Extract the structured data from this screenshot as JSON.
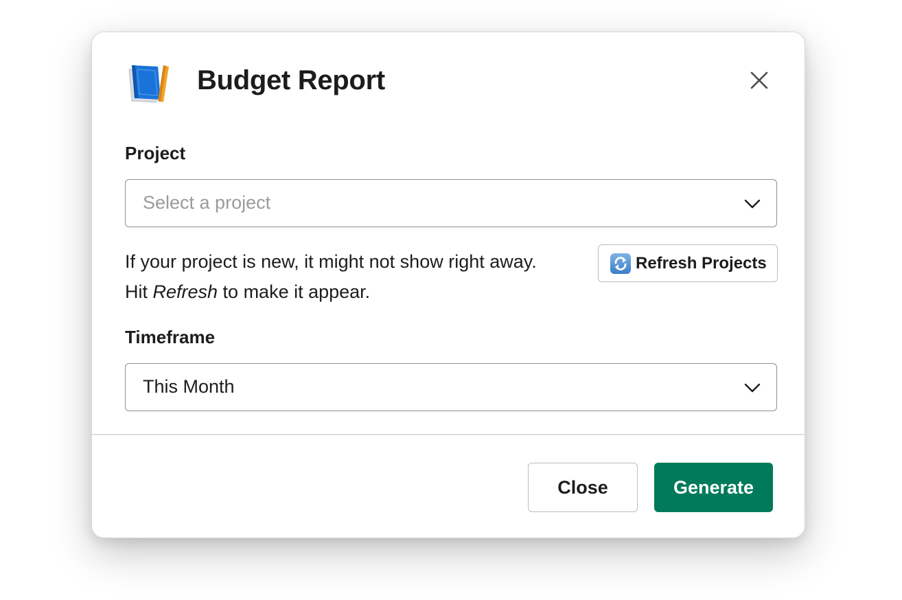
{
  "modal": {
    "title": "Budget Report",
    "title_icon": "blue-book-icon",
    "close_icon": "close-icon"
  },
  "form": {
    "project": {
      "label": "Project",
      "placeholder": "Select a project",
      "icon": "chevron-down-icon"
    },
    "help": {
      "text_before": "If your project is new, it might not show right away. Hit ",
      "text_emphasis": "Refresh",
      "text_after": " to make it appear."
    },
    "refresh_button": {
      "label": "Refresh Projects",
      "icon": "refresh-arrows-icon"
    },
    "timeframe": {
      "label": "Timeframe",
      "value": "This Month",
      "icon": "chevron-down-icon"
    }
  },
  "footer": {
    "close_label": "Close",
    "generate_label": "Generate"
  },
  "colors": {
    "primary": "#007a5a",
    "text": "#1d1c1d",
    "placeholder": "#9b9b9c",
    "border": "#8d8d8f"
  }
}
